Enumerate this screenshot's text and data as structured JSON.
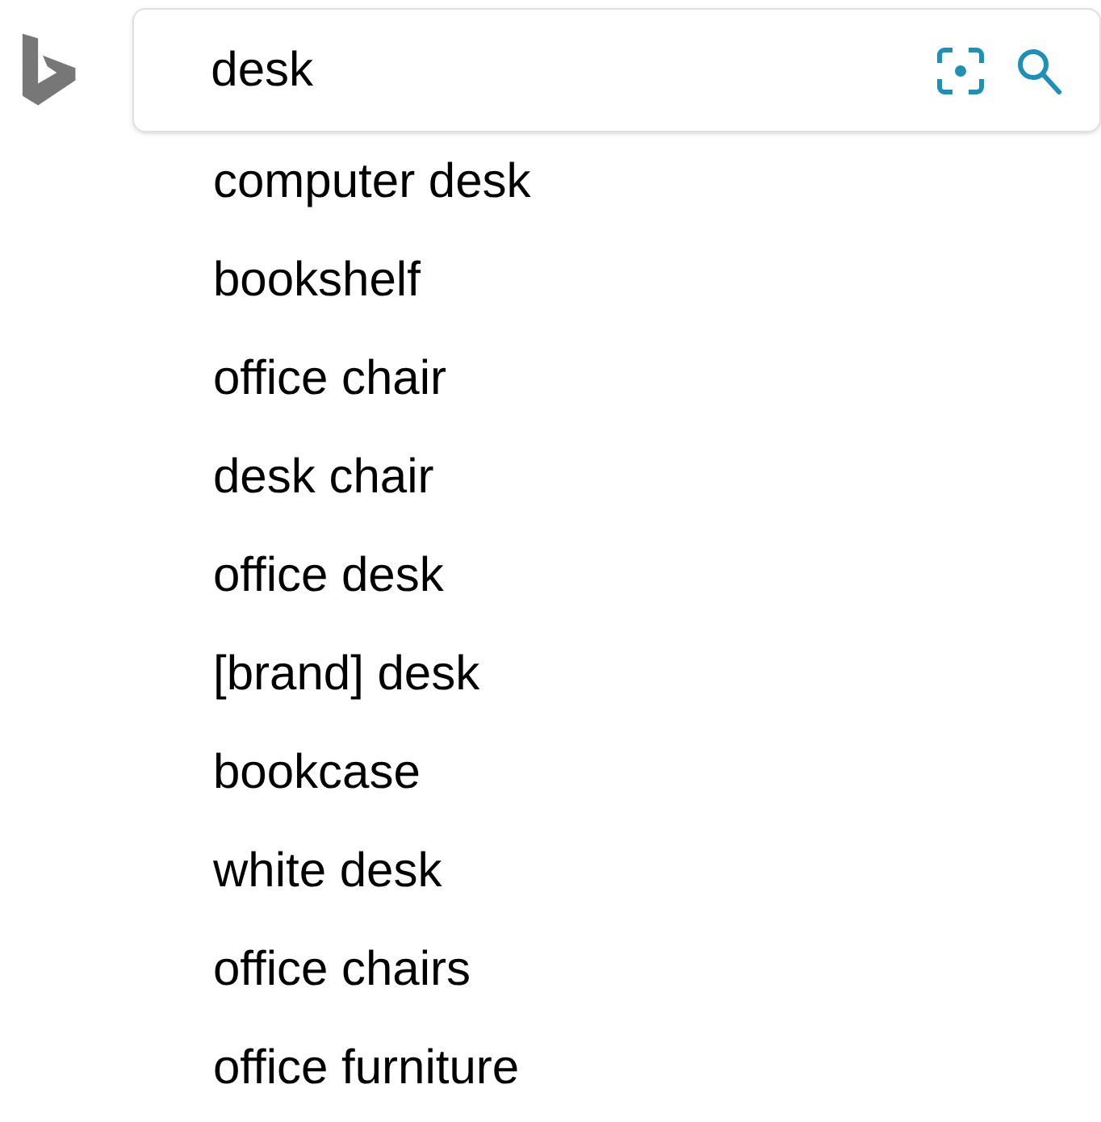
{
  "search": {
    "value": "desk"
  },
  "suggestions": [
    "computer desk",
    "bookshelf",
    "office chair",
    "desk chair",
    "office desk",
    "[brand] desk",
    "bookcase",
    "white desk",
    "office chairs",
    "office furniture"
  ]
}
